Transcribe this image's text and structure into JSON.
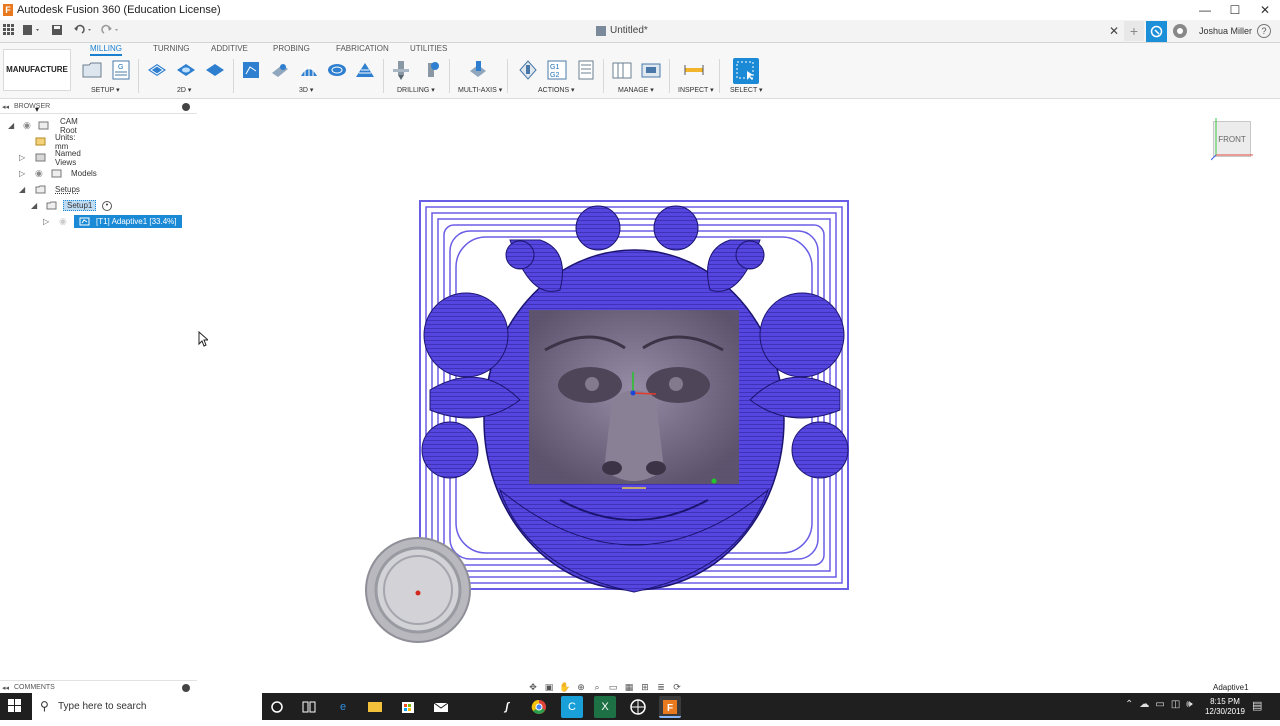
{
  "window": {
    "title": "Autodesk Fusion 360 (Education License)",
    "logo_letter": "F",
    "minimize": "—",
    "maximize": "☐",
    "close": "✕"
  },
  "tabbar": {
    "document": "Untitled*",
    "close": "✕",
    "new_tab": "+",
    "user": "Joshua Miller"
  },
  "ribbon": {
    "workspace": "MANUFACTURE ▾",
    "tabs": [
      "MILLING",
      "TURNING",
      "ADDITIVE",
      "PROBING",
      "FABRICATION",
      "UTILITIES"
    ],
    "active_tab": "MILLING",
    "groups": [
      "SETUP ▾",
      "2D ▾",
      "3D ▾",
      "DRILLING ▾",
      "MULTI-AXIS ▾",
      "ACTIONS ▾",
      "MANAGE ▾",
      "INSPECT ▾",
      "SELECT ▾"
    ]
  },
  "browser": {
    "title": "BROWSER",
    "items": [
      {
        "label": "CAM Root"
      },
      {
        "label": "Units: mm"
      },
      {
        "label": "Named Views"
      },
      {
        "label": "Models"
      },
      {
        "label": "Setups"
      },
      {
        "label": "Setup1"
      },
      {
        "label": "[T1] Adaptive1 [33.4%]"
      }
    ]
  },
  "viewcube": {
    "face": "FRONT"
  },
  "comments": {
    "title": "COMMENTS"
  },
  "status": {
    "right": "Adaptive1"
  },
  "taskbar": {
    "search_placeholder": "Type here to search",
    "time": "8:15 PM",
    "date": "12/30/2019"
  },
  "colors": {
    "accent": "#1b8ad6",
    "toolpath": "#4a3ad8",
    "stock": "#6e6478"
  }
}
